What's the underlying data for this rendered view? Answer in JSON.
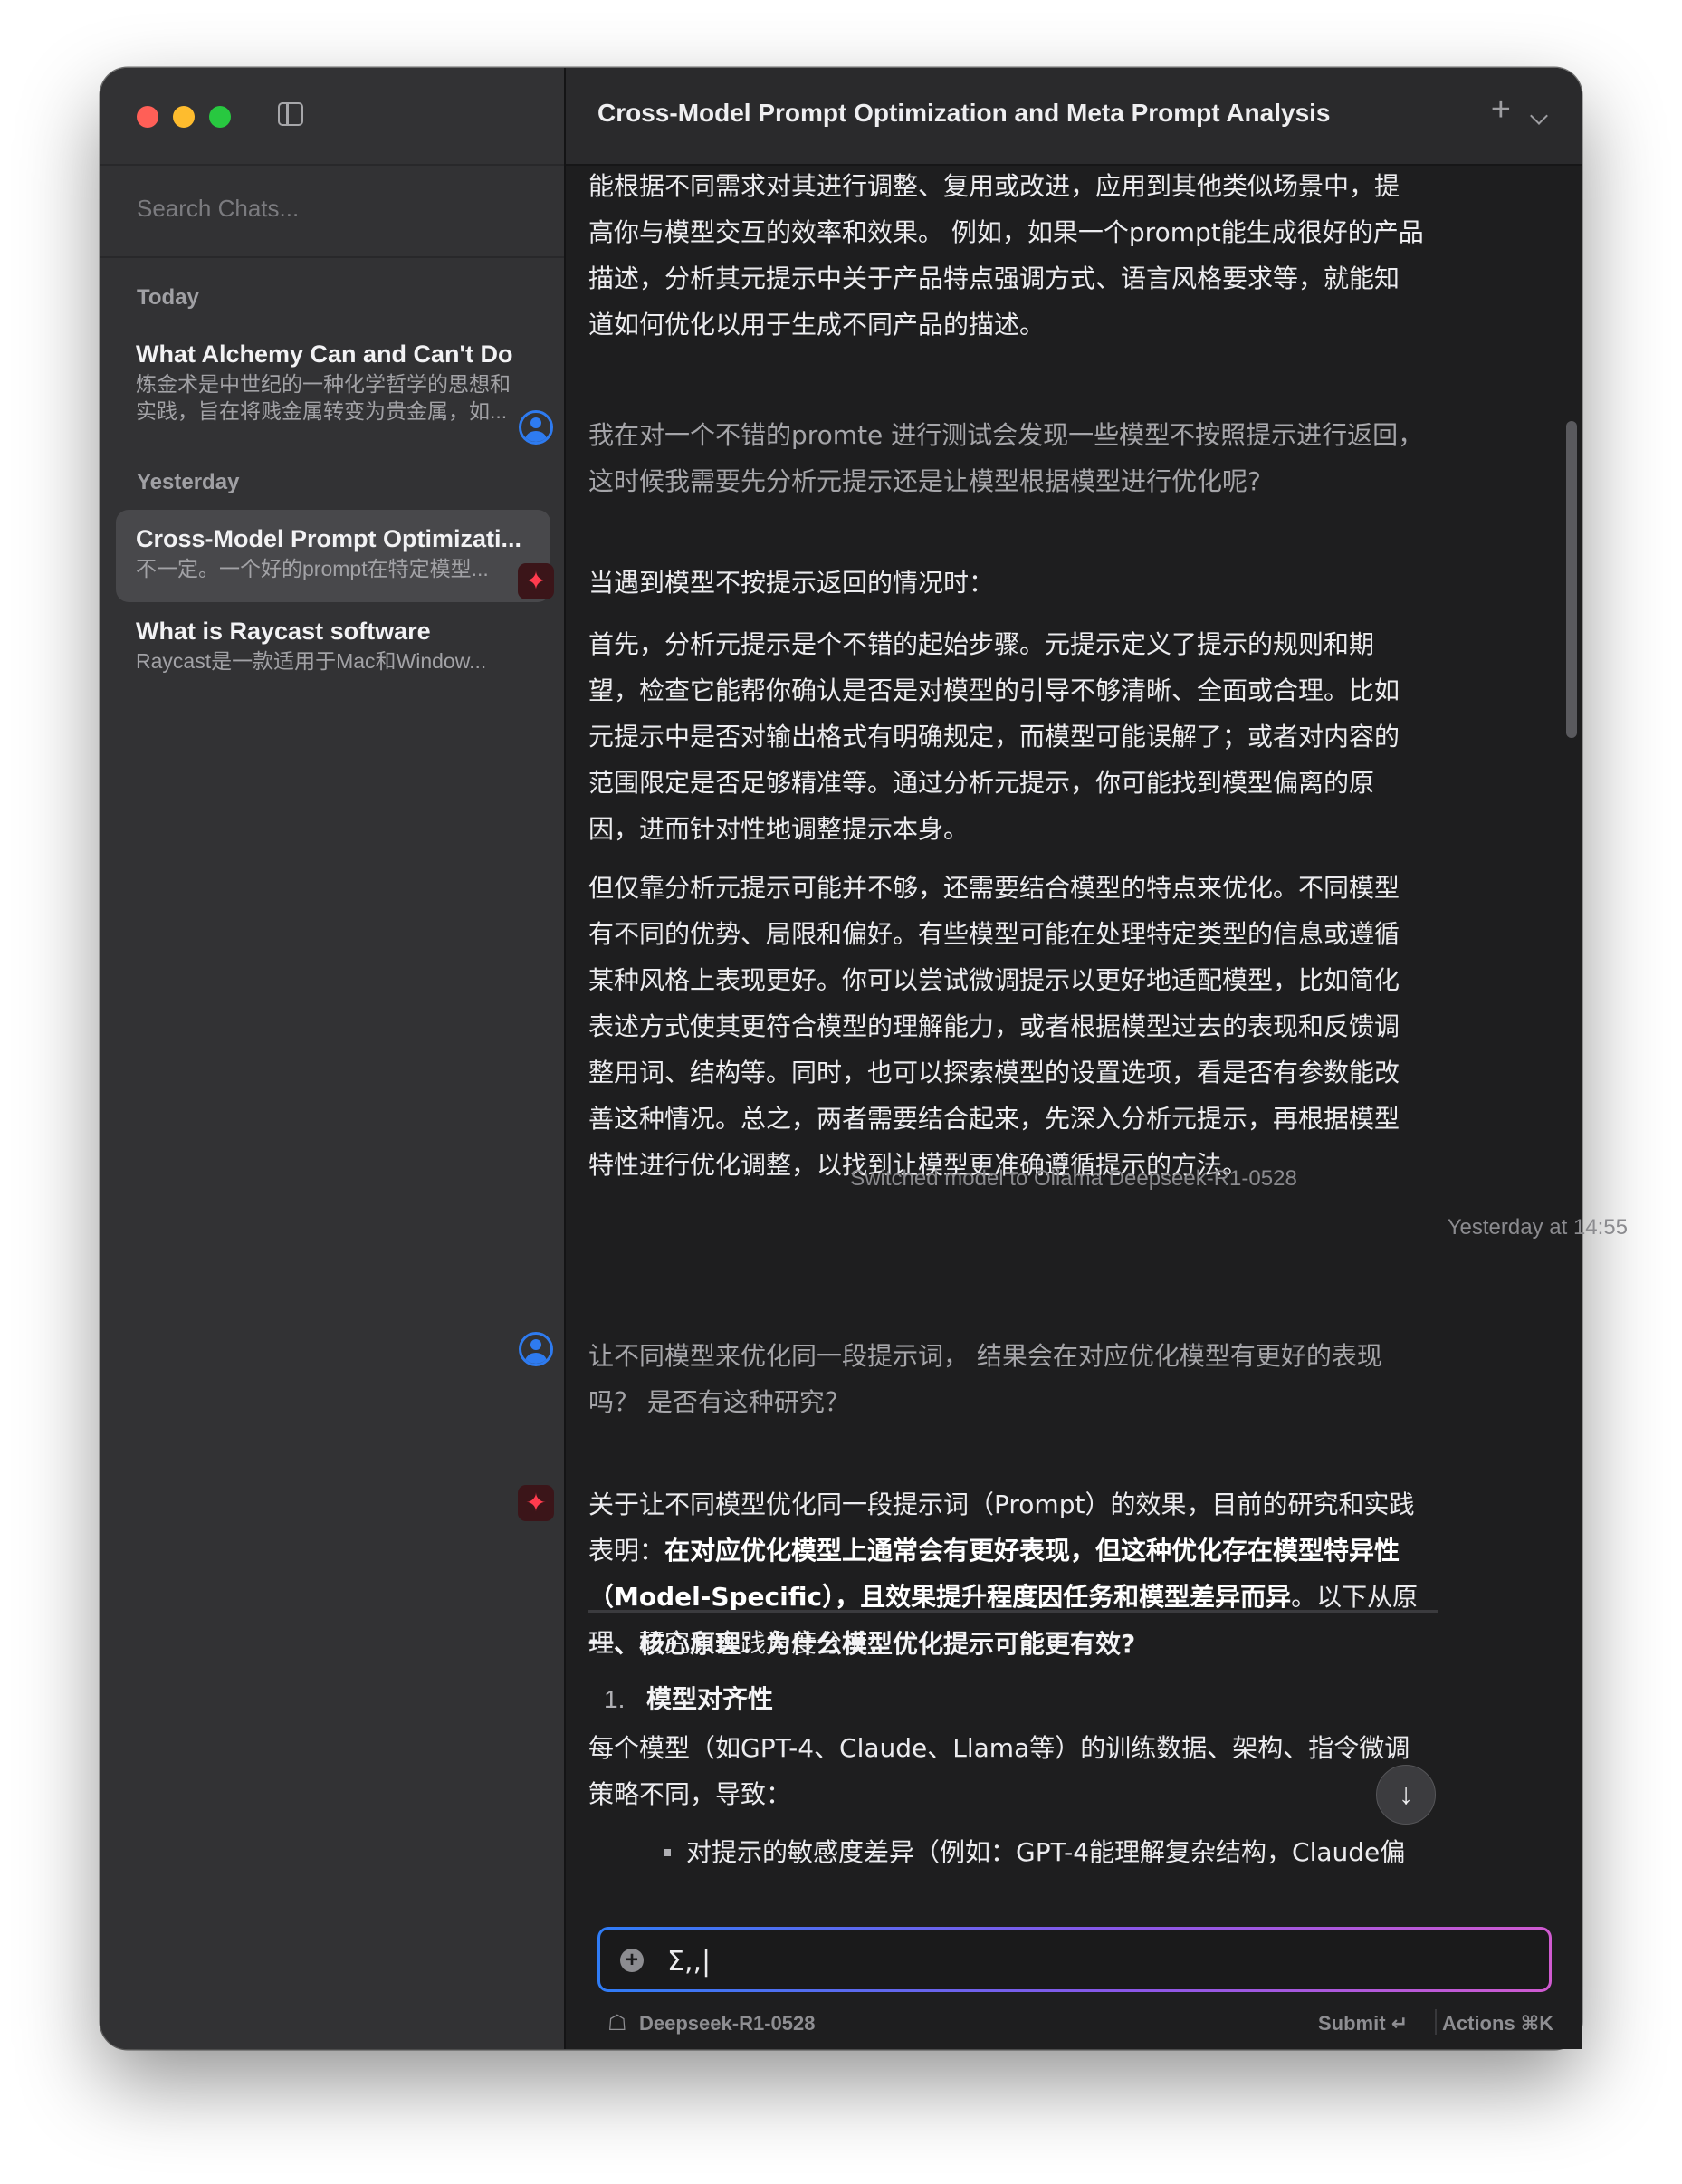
{
  "window": {
    "title": "Cross-Model Prompt Optimization and Meta Prompt Analysis"
  },
  "sidebar": {
    "search_placeholder": "Search Chats...",
    "sections": [
      {
        "label": "Today",
        "items": [
          {
            "title": "What Alchemy Can and Can't Do",
            "preview": "炼金术是中世纪的一种化学哲学的思想和实践，旨在将贱金属转变为贵金属，如...",
            "selected": false
          }
        ]
      },
      {
        "label": "Yesterday",
        "items": [
          {
            "title": "Cross-Model Prompt Optimizati...",
            "preview": "不一定。一个好的prompt在特定模型...",
            "selected": true
          },
          {
            "title": "What is Raycast software",
            "preview": "Raycast是一款适用于Mac和Window...",
            "selected": false
          }
        ]
      }
    ]
  },
  "header": {
    "new_chat_icon": "plus-icon",
    "menu_icon": "chevron-down-icon"
  },
  "messages": {
    "top_fragment": [
      "能根据不同需求对其进行调整、复用或改进，应用到其他类似场景中，提",
      "高你与模型交互的效率和效果。 例如，如果一个prompt能生成很好的产品",
      "描述，分析其元提示中关于产品特点强调方式、语言风格要求等，就能知",
      "道如何优化以用于生成不同产品的描述。"
    ],
    "user_1": [
      "我在对一个不错的promte 进行测试会发现一些模型不按照提示进行返回，",
      "这时候我需要先分析元提示还是让模型根据模型进行优化呢?"
    ],
    "ai_1_intro": "当遇到模型不按提示返回的情况时：",
    "ai_1_p1": [
      "首先，分析元提示是个不错的起始步骤。元提示定义了提示的规则和期",
      "望，检查它能帮你确认是否是对模型的引导不够清晰、全面或合理。比如",
      "元提示中是否对输出格式有明确规定，而模型可能误解了；或者对内容的",
      "范围限定是否足够精准等。通过分析元提示，你可能找到模型偏离的原",
      "因，进而针对性地调整提示本身。"
    ],
    "ai_1_p2": [
      "但仅靠分析元提示可能并不够，还需要结合模型的特点来优化。不同模型",
      "有不同的优势、局限和偏好。有些模型可能在处理特定类型的信息或遵循",
      "某种风格上表现更好。你可以尝试微调提示以更好地适配模型，比如简化",
      "表述方式使其更符合模型的理解能力，或者根据模型过去的表现和反馈调",
      "整用词、结构等。同时，也可以探索模型的设置选项，看是否有参数能改",
      "善这种情况。总之，两者需要结合起来，先深入分析元提示，再根据模型",
      "特性进行优化调整，以找到让模型更准确遵循提示的方法。"
    ],
    "system_note": "Switched model to Ollama Deepseek-R1-0528",
    "timestamp": "Yesterday at 14:55",
    "user_2": [
      "让不同模型来优化同一段提示词， 结果会在对应优化模型有更好的表现",
      "吗？ 是否有这种研究？"
    ],
    "ai_2": {
      "line1": "关于让不同模型优化同一段提示词（Prompt）的效果，目前的研究和实践",
      "line2_plain": "表明：",
      "line2_bold": "在对应优化模型上通常会有更好表现，但这种优化存在模型特异性",
      "line3_bold": "（Model-Specific），且效果提升程度因任务和模型差异而异",
      "line3_plain": "。以下从原",
      "line4": "理、研究和实践角度分析：",
      "heading": "一、核心原理：为什么模型优化提示可能更有效?",
      "list_number": "1.",
      "list_title": "模型对齐性",
      "body": [
        "每个模型（如GPT-4、Claude、Llama等）的训练数据、架构、指令微调",
        "策略不同，导致："
      ],
      "bullet": "对提示的敏感度差异（例如：GPT-4能理解复杂结构，Claude偏"
    }
  },
  "composer": {
    "value": "Σ,,|",
    "attach_icon": "plus-circle-icon"
  },
  "footer": {
    "model_icon": "llama-icon",
    "model_name": "Deepseek-R1-0528",
    "submit_label": "Submit ↵",
    "actions_label": "Actions ⌘K"
  },
  "colors": {
    "window_bg": "#1e1e1f",
    "sidebar_bg": "#323234",
    "user_avatar": "#2e7bf0",
    "ai_avatar": "#ff3b4e",
    "composer_border_start": "#2f7cf6",
    "composer_border_end": "#d05ad0"
  }
}
